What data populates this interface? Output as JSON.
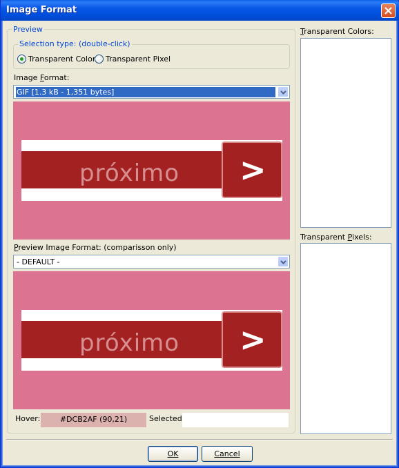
{
  "window": {
    "title": "Image Format"
  },
  "preview_group": {
    "legend": "Preview",
    "selection_type": {
      "legend": "Selection type: (double-click)",
      "options": [
        {
          "label": "Transparent Color",
          "selected": true
        },
        {
          "label": "Transparent Pixel",
          "selected": false
        }
      ]
    },
    "image_format_label": "Image Format:",
    "image_format_value": "GIF   [1.3 kB - 1,351 bytes]",
    "preview_format_label": "Preview Image Format: (comparisson only)",
    "preview_format_value": "- DEFAULT -",
    "banner_text": "próximo",
    "banner_arrow": ">",
    "hover_label": "Hover:",
    "hover_value": "#DCB2AF (90,21)",
    "selected_label": "Selected:",
    "selected_value": ""
  },
  "right_panel": {
    "transparent_colors_label": "Transparent Colors:",
    "transparent_pixels_label": "Transparent Pixels:"
  },
  "buttons": {
    "ok": "OK",
    "cancel": "Cancel"
  },
  "colors": {
    "preview_bg": "#dc7391",
    "banner_red": "#a32221",
    "hover_swatch": "#dcb2af",
    "titlebar": "#0a57e6"
  },
  "icons": {
    "close": "close-icon",
    "dropdown": "chevron-down-icon"
  }
}
